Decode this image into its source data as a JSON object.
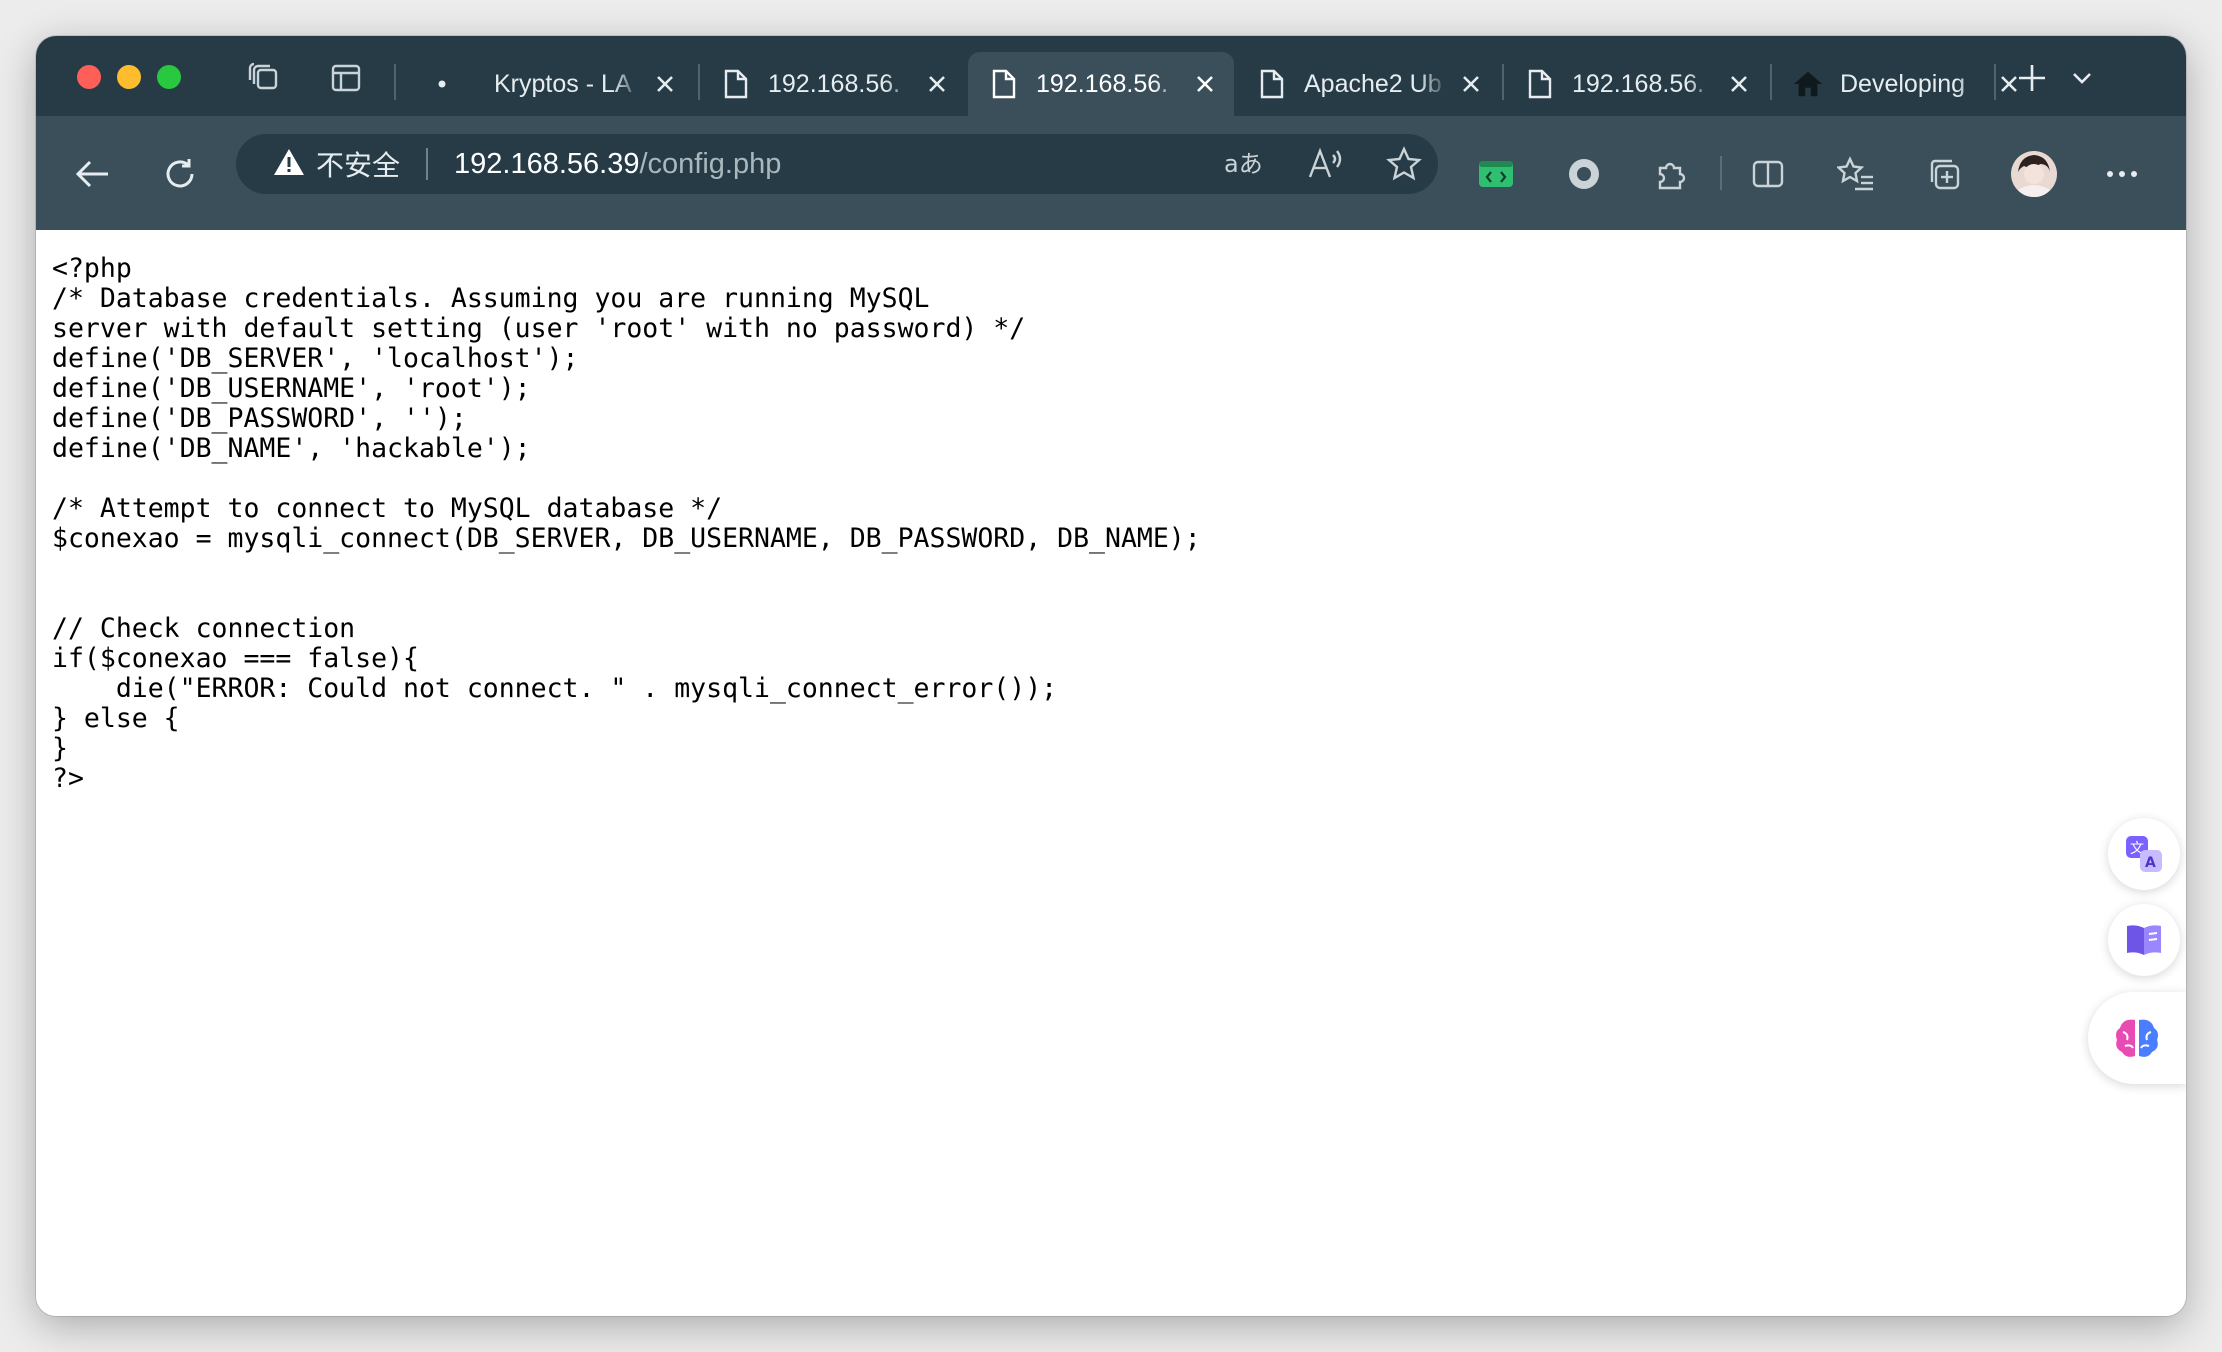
{
  "tabs": [
    {
      "title": "Kryptos - LA",
      "icon": "dot-icon",
      "active": false
    },
    {
      "title": "192.168.56.",
      "icon": "document-icon",
      "active": false
    },
    {
      "title": "192.168.56.",
      "icon": "document-icon",
      "active": true
    },
    {
      "title": "Apache2 Ub",
      "icon": "document-icon",
      "active": false
    },
    {
      "title": "192.168.56.",
      "icon": "document-icon",
      "active": false
    },
    {
      "title": "Developing",
      "icon": "home-icon",
      "active": false
    }
  ],
  "address_bar": {
    "security_label": "不安全",
    "url_host": "192.168.56.39",
    "url_path": "/config.php"
  },
  "page": {
    "source_code": "<?php\n/* Database credentials. Assuming you are running MySQL\nserver with default setting (user 'root' with no password) */\ndefine('DB_SERVER', 'localhost');\ndefine('DB_USERNAME', 'root');\ndefine('DB_PASSWORD', '');\ndefine('DB_NAME', 'hackable');\n\n/* Attempt to connect to MySQL database */\n$conexao = mysqli_connect(DB_SERVER, DB_USERNAME, DB_PASSWORD, DB_NAME);\n\n\n// Check connection\nif($conexao === false){\n    die(\"ERROR: Could not connect. \" . mysqli_connect_error());\n} else {\n}\n?>"
  },
  "colors": {
    "titlebar": "#263b45",
    "toolbar": "#3a4f59",
    "active_tab": "#3a4f59",
    "traffic_red": "#fe5f57",
    "traffic_yellow": "#febc2e",
    "traffic_green": "#28c840"
  }
}
